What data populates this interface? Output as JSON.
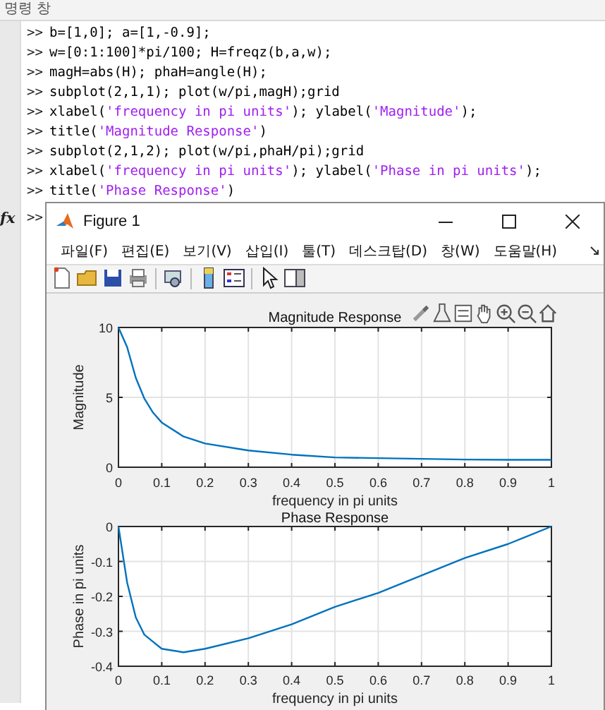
{
  "command_window": {
    "title": "명령 창",
    "lines": [
      {
        "prompt": ">>",
        "segments": [
          {
            "kind": "code",
            "text": "b=[1,0]; a=[1,-0.9];"
          }
        ]
      },
      {
        "prompt": ">>",
        "segments": [
          {
            "kind": "code",
            "text": "w=[0:1:100]*pi/100; H=freqz(b,a,w);"
          }
        ]
      },
      {
        "prompt": ">>",
        "segments": [
          {
            "kind": "code",
            "text": "magH=abs(H); phaH=angle(H);"
          }
        ]
      },
      {
        "prompt": ">>",
        "segments": [
          {
            "kind": "code",
            "text": "subplot(2,1,1); plot(w/pi,magH);grid"
          }
        ]
      },
      {
        "prompt": ">>",
        "segments": [
          {
            "kind": "code",
            "text": "xlabel("
          },
          {
            "kind": "string",
            "text": "'frequency in pi units'"
          },
          {
            "kind": "code",
            "text": "); ylabel("
          },
          {
            "kind": "string",
            "text": "'Magnitude'"
          },
          {
            "kind": "code",
            "text": ");"
          }
        ]
      },
      {
        "prompt": ">>",
        "segments": [
          {
            "kind": "code",
            "text": "title("
          },
          {
            "kind": "string",
            "text": "'Magnitude Response'"
          },
          {
            "kind": "code",
            "text": ")"
          }
        ]
      },
      {
        "prompt": ">>",
        "segments": [
          {
            "kind": "code",
            "text": "subplot(2,1,2); plot(w/pi,phaH/pi);grid"
          }
        ]
      },
      {
        "prompt": ">>",
        "segments": [
          {
            "kind": "code",
            "text": "xlabel("
          },
          {
            "kind": "string",
            "text": "'frequency in pi units'"
          },
          {
            "kind": "code",
            "text": "); ylabel("
          },
          {
            "kind": "string",
            "text": "'Phase in pi units'"
          },
          {
            "kind": "code",
            "text": ");"
          }
        ]
      },
      {
        "prompt": ">>",
        "segments": [
          {
            "kind": "code",
            "text": "title("
          },
          {
            "kind": "string",
            "text": "'Phase Response'"
          },
          {
            "kind": "code",
            "text": ")"
          }
        ]
      }
    ],
    "input_prompt": ">>",
    "fx_label": "fx"
  },
  "figure": {
    "title": "Figure 1",
    "menu": [
      "파일(F)",
      "편집(E)",
      "보기(V)",
      "삽입(I)",
      "툴(T)",
      "데스크탑(D)",
      "창(W)",
      "도움말(H)"
    ],
    "axes": [
      {
        "chart_data": {
          "type": "line",
          "title": "Magnitude Response",
          "xlabel": "frequency in pi units",
          "ylabel": "Magnitude",
          "x": [
            0,
            0.02,
            0.04,
            0.06,
            0.08,
            0.1,
            0.15,
            0.2,
            0.3,
            0.4,
            0.5,
            0.6,
            0.7,
            0.8,
            0.9,
            1
          ],
          "series": [
            {
              "color": "#0072bd",
              "values": [
                10,
                8.6,
                6.4,
                4.9,
                3.9,
                3.2,
                2.2,
                1.7,
                1.2,
                0.9,
                0.7,
                0.65,
                0.6,
                0.55,
                0.53,
                0.53
              ]
            }
          ],
          "grid": true,
          "xlim": [
            0,
            1
          ],
          "ylim": [
            0,
            10
          ],
          "xticks": [
            0,
            0.1,
            0.2,
            0.3,
            0.4,
            0.5,
            0.6,
            0.7,
            0.8,
            0.9,
            1
          ],
          "yticks": [
            0,
            5,
            10
          ]
        }
      },
      {
        "chart_data": {
          "type": "line",
          "title": "Phase Response",
          "xlabel": "frequency in pi units",
          "ylabel": "Phase in pi units",
          "x": [
            0,
            0.02,
            0.04,
            0.06,
            0.08,
            0.1,
            0.15,
            0.2,
            0.3,
            0.4,
            0.5,
            0.6,
            0.7,
            0.8,
            0.9,
            1
          ],
          "series": [
            {
              "color": "#0072bd",
              "values": [
                0,
                -0.16,
                -0.26,
                -0.31,
                -0.33,
                -0.35,
                -0.36,
                -0.35,
                -0.32,
                -0.28,
                -0.23,
                -0.19,
                -0.14,
                -0.09,
                -0.05,
                0
              ]
            }
          ],
          "grid": true,
          "xlim": [
            0,
            1
          ],
          "ylim": [
            -0.4,
            0
          ],
          "xticks": [
            0,
            0.1,
            0.2,
            0.3,
            0.4,
            0.5,
            0.6,
            0.7,
            0.8,
            0.9,
            1
          ],
          "yticks": [
            -0.4,
            -0.3,
            -0.2,
            -0.1,
            0
          ]
        }
      }
    ]
  }
}
